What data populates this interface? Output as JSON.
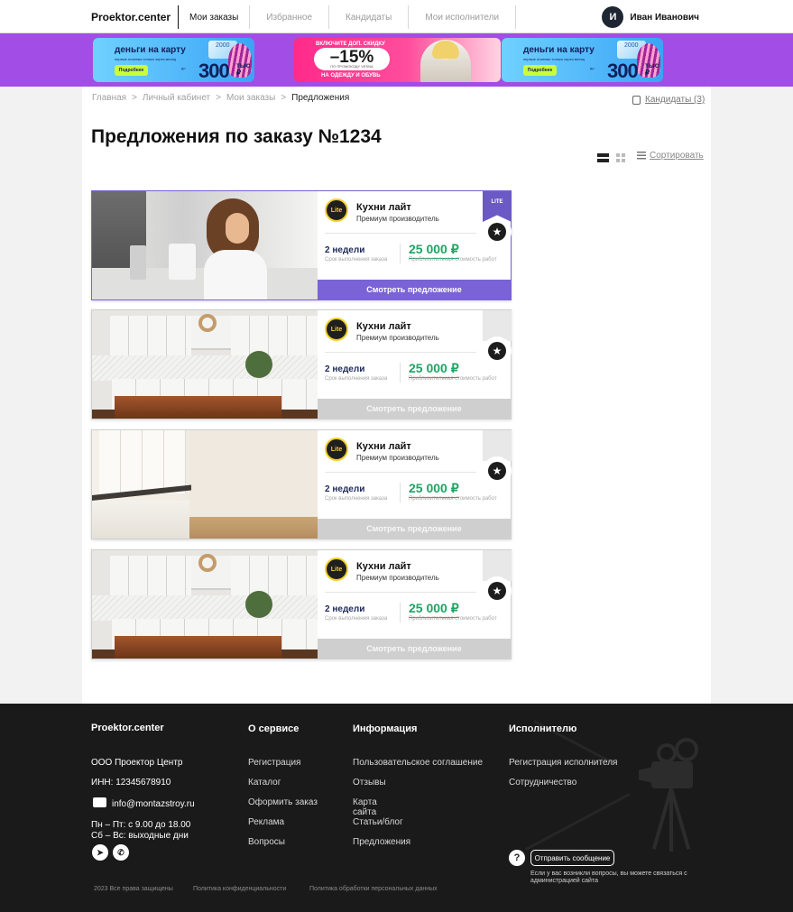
{
  "header": {
    "logo": "Proektor.center",
    "nav": [
      "Мои заказы",
      "Избранное",
      "Кандидаты",
      "Мои исполнители"
    ],
    "user_initial": "И",
    "user_name": "Иван Иванович"
  },
  "banners": [
    {
      "title": "деньги на карту",
      "subtitle": "первые платежи только через месяц",
      "button": "Подробнее",
      "amount_prefix": "до",
      "amount": "300",
      "amount_suffix": "тыс ₽",
      "card_number": "2000"
    },
    {
      "top": "ВКЛЮЧИТЕ ДОП. СКИДКУ",
      "discount": "–15%",
      "code": "ПО ПРОМОКОДУ VESNA",
      "bottom": "НА ОДЕЖДУ И ОБУВЬ"
    },
    {
      "title": "деньги на карту",
      "subtitle": "первые платежи только через месяц",
      "button": "Подробнее",
      "amount_prefix": "до",
      "amount": "300",
      "amount_suffix": "тыс ₽",
      "card_number": "2000"
    }
  ],
  "breadcrumb": [
    "Главная",
    "Личный кабинет",
    "Мои заказы",
    "Предложения"
  ],
  "breadcrumb_sep": ">",
  "candidates_link": "Кандидаты (3)",
  "page_title": "Предложения по заказу №1234",
  "sort_label": "Сортировать",
  "offers": [
    {
      "company": "Кухни лайт",
      "subtitle": "Премиум производитель",
      "logo_text": "Lite",
      "term": "2 недели",
      "term_label": "Срок выполнения заказа",
      "price": "25 000 ₽",
      "price_label": "Приблизительная стоимость работ",
      "badge": "LITE",
      "button": "Смотреть предложение",
      "active": true
    },
    {
      "company": "Кухни лайт",
      "subtitle": "Премиум производитель",
      "logo_text": "Lite",
      "term": "2 недели",
      "term_label": "Срок выполнения заказа",
      "price": "25 000 ₽",
      "price_label": "Приблизительная стоимость работ",
      "badge": "",
      "button": "Смотреть предложение",
      "active": false
    },
    {
      "company": "Кухни лайт",
      "subtitle": "Премиум производитель",
      "logo_text": "Lite",
      "term": "2 недели",
      "term_label": "Срок выполнения заказа",
      "price": "25 000 ₽",
      "price_label": "Приблизительная стоимость работ",
      "badge": "",
      "button": "Смотреть предложение",
      "active": false
    },
    {
      "company": "Кухни лайт",
      "subtitle": "Премиум производитель",
      "logo_text": "Lite",
      "term": "2 недели",
      "term_label": "Срок выполнения заказа",
      "price": "25 000 ₽",
      "price_label": "Приблизительная стоимость работ",
      "badge": "",
      "button": "Смотреть предложение",
      "active": false
    }
  ],
  "footer": {
    "logo": "Proektor.center",
    "company": "ООО Проектор Центр",
    "inn": "ИНН: 12345678910",
    "email": "info@montazstroy.ru",
    "hours_weekdays": "Пн – Пт: с 9.00 до 18.00",
    "hours_weekend": "Сб – Вс: выходные дни",
    "social": [
      {
        "icon": "telegram-icon",
        "glyph": "➤"
      },
      {
        "icon": "whatsapp-icon",
        "glyph": "✆"
      }
    ],
    "about": {
      "title": "О сервисе",
      "links": [
        "Регистрация",
        "Каталог",
        "Оформить заказ",
        "Реклама",
        "Вопросы"
      ]
    },
    "info": {
      "title": "Информация",
      "links": [
        "Пользовательское соглашение",
        "Отзывы",
        "Карта сайта",
        "Статьи/блог",
        "Предложения"
      ]
    },
    "executor": {
      "title": "Исполнителю",
      "links": [
        "Регистрация исполнителя",
        "Сотрудничество"
      ]
    },
    "send_message": "Отправить сообщение",
    "help_text": "Если у вас возникли вопросы, вы можете связаться с администрацией сайта",
    "copyright": "2023 Все права защищены",
    "privacy": "Политика конфиденциальности",
    "personal_data": "Политика обработки персональных данных"
  },
  "colors": {
    "accent": "#7a63d6",
    "banner_bg": "#a24de6",
    "price_green": "#1ea463",
    "footer_bg": "#1a1a1a",
    "inactive_button": "#cfcfcf"
  }
}
